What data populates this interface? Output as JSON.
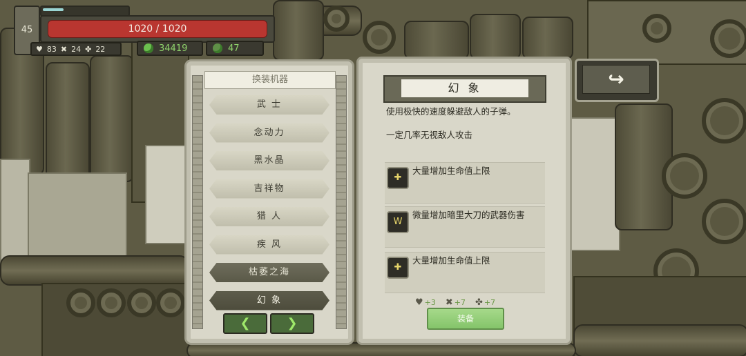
{
  "player": {
    "level": "45",
    "xp_fraction": 0.24,
    "hp_text": "1020 / 1020",
    "stats": [
      {
        "icon": "heart-icon",
        "glyph": "♥",
        "value": "83"
      },
      {
        "icon": "crossed-tools-icon",
        "glyph": "✖",
        "value": "24"
      },
      {
        "icon": "clover-icon",
        "glyph": "✤",
        "value": "22"
      }
    ]
  },
  "currency": {
    "gems": {
      "icon": "gem-icon",
      "value": "34419"
    },
    "crystals": {
      "icon": "green-crystal-icon",
      "value": "47"
    }
  },
  "machine_list": {
    "header": "换装机器",
    "items": [
      {
        "label": "武 士",
        "style": "light"
      },
      {
        "label": "念动力",
        "style": "light"
      },
      {
        "label": "黑水晶",
        "style": "light"
      },
      {
        "label": "吉祥物",
        "style": "light"
      },
      {
        "label": "猎 人",
        "style": "light"
      },
      {
        "label": "疾 风",
        "style": "light"
      },
      {
        "label": "枯萎之海",
        "style": "dark"
      },
      {
        "label": "幻 象",
        "style": "selected"
      }
    ],
    "prev_glyph": "❮",
    "next_glyph": "❯"
  },
  "detail": {
    "title": "幻 象",
    "description": [
      "使用极快的速度躲避敌人的子弹。",
      "一定几率无视敌人攻击"
    ],
    "perks": [
      {
        "icon": "health-up-icon",
        "glyph": "✚",
        "text": "大量增加生命值上限"
      },
      {
        "icon": "weapon-damage-icon",
        "glyph": "W",
        "text": "微量增加暗里大刀的武器伤害"
      },
      {
        "icon": "health-up-icon",
        "glyph": "✚",
        "text": "大量增加生命值上限"
      }
    ],
    "bonuses": [
      {
        "icon": "heart-icon",
        "glyph": "♥",
        "value": "3"
      },
      {
        "icon": "crossed-tools-icon",
        "glyph": "✖",
        "value": "7"
      },
      {
        "icon": "clover-icon",
        "glyph": "✤",
        "value": "7"
      }
    ],
    "equip_label": "装备"
  },
  "back_glyph": "↪",
  "colors": {
    "hp_bar": "#b93630",
    "equip_button": "#9ed383",
    "bonus_text": "#6b9a47",
    "currency_text": "#8fd36b"
  }
}
